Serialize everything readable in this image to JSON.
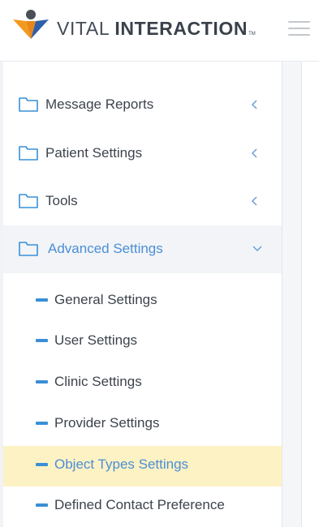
{
  "header": {
    "brand_light": "VITAL ",
    "brand_bold": "INTERACTION",
    "trademark": "TM",
    "colors": {
      "logo_orange": "#f39a1e",
      "logo_blue": "#2f5fa8",
      "logo_dark": "#4a4f57"
    }
  },
  "sidebar": {
    "items": [
      {
        "label": "Message Reports",
        "icon": "folder-icon",
        "chevron": "chevron-left-icon"
      },
      {
        "label": "Patient Settings",
        "icon": "folder-icon",
        "chevron": "chevron-left-icon"
      },
      {
        "label": "Tools",
        "icon": "folder-icon",
        "chevron": "chevron-left-icon"
      },
      {
        "label": "Advanced Settings",
        "icon": "folder-icon",
        "chevron": "chevron-down-icon",
        "expanded": true
      }
    ],
    "submenu": [
      {
        "label": "General Settings"
      },
      {
        "label": "User Settings"
      },
      {
        "label": "Clinic Settings"
      },
      {
        "label": "Provider Settings"
      },
      {
        "label": "Object Types Settings",
        "selected": true
      },
      {
        "label": "Defined Contact Preference"
      }
    ],
    "colors": {
      "accent": "#4b8ed6",
      "selected_bg": "#fdf2c4",
      "dash": "#3a8fd6"
    }
  }
}
